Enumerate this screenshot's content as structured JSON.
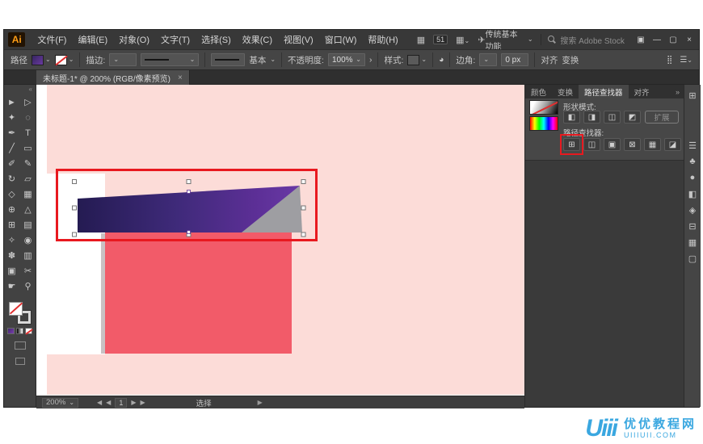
{
  "menubar": {
    "logo": "Ai",
    "menus": [
      {
        "name": "menu-file",
        "label": "文件(F)"
      },
      {
        "name": "menu-edit",
        "label": "编辑(E)"
      },
      {
        "name": "menu-object",
        "label": "对象(O)"
      },
      {
        "name": "menu-type",
        "label": "文字(T)"
      },
      {
        "name": "menu-select",
        "label": "选择(S)"
      },
      {
        "name": "menu-effect",
        "label": "效果(C)"
      },
      {
        "name": "menu-view",
        "label": "视图(V)"
      },
      {
        "name": "menu-window",
        "label": "窗口(W)"
      },
      {
        "name": "menu-help",
        "label": "帮助(H)"
      }
    ],
    "badge": "51",
    "workspace": "传统基本功能",
    "search_placeholder": "搜索 Adobe Stock"
  },
  "controlbar": {
    "path_label": "路径",
    "stroke_label": "描边:",
    "brush_name": "基本",
    "opacity_label": "不透明度:",
    "opacity_value": "100%",
    "style_label": "样式:",
    "corner_label": "边角:",
    "corner_value": "0 px",
    "align_label": "对齐",
    "transform_label": "变换"
  },
  "tabbar": {
    "doc_title": "未标题-1* @ 200% (RGB/像素预览)"
  },
  "toolbar": {
    "tools": [
      {
        "name": "selection-tool",
        "glyph": "►"
      },
      {
        "name": "direct-selection-tool",
        "glyph": "▷"
      },
      {
        "name": "magic-wand-tool",
        "glyph": "✦"
      },
      {
        "name": "lasso-tool",
        "glyph": "◌"
      },
      {
        "name": "pen-tool",
        "glyph": "✒"
      },
      {
        "name": "type-tool",
        "glyph": "T"
      },
      {
        "name": "line-segment-tool",
        "glyph": "╱"
      },
      {
        "name": "rectangle-tool",
        "glyph": "▭"
      },
      {
        "name": "paintbrush-tool",
        "glyph": "✐"
      },
      {
        "name": "pencil-tool",
        "glyph": "✎"
      },
      {
        "name": "rotate-tool",
        "glyph": "↻"
      },
      {
        "name": "scale-tool",
        "glyph": "▱"
      },
      {
        "name": "width-tool",
        "glyph": "◇"
      },
      {
        "name": "free-transform-tool",
        "glyph": "▦"
      },
      {
        "name": "shape-builder-tool",
        "glyph": "⊕"
      },
      {
        "name": "perspective-grid-tool",
        "glyph": "△"
      },
      {
        "name": "mesh-tool",
        "glyph": "⊞"
      },
      {
        "name": "gradient-tool",
        "glyph": "▤"
      },
      {
        "name": "eyedropper-tool",
        "glyph": "✧"
      },
      {
        "name": "blend-tool",
        "glyph": "◉"
      },
      {
        "name": "symbol-sprayer-tool",
        "glyph": "✽"
      },
      {
        "name": "column-graph-tool",
        "glyph": "▥"
      },
      {
        "name": "artboard-tool",
        "glyph": "▣"
      },
      {
        "name": "slice-tool",
        "glyph": "✂"
      },
      {
        "name": "hand-tool",
        "glyph": "☛"
      },
      {
        "name": "zoom-tool",
        "glyph": "⚲"
      }
    ]
  },
  "panels": {
    "tabs": [
      {
        "name": "tab-color",
        "label": "颜色"
      },
      {
        "name": "tab-transform",
        "label": "变换"
      },
      {
        "name": "tab-pathfinder",
        "label": "路径查找器"
      },
      {
        "name": "tab-align",
        "label": "对齐"
      }
    ],
    "shape_modes_label": "形状模式:",
    "shape_mode_buttons": [
      {
        "name": "unite-button",
        "glyph": "◧"
      },
      {
        "name": "minus-front-button",
        "glyph": "◨"
      },
      {
        "name": "intersect-button",
        "glyph": "◫"
      },
      {
        "name": "exclude-button",
        "glyph": "◩"
      }
    ],
    "expand_label": "扩展",
    "pathfinders_label": "路径查找器:",
    "pathfinder_buttons": [
      {
        "name": "divide-button",
        "glyph": "⊞"
      },
      {
        "name": "trim-button",
        "glyph": "◫"
      },
      {
        "name": "merge-button",
        "glyph": "▣"
      },
      {
        "name": "crop-button",
        "glyph": "⊠"
      },
      {
        "name": "outline-button",
        "glyph": "▦"
      },
      {
        "name": "minus-back-button",
        "glyph": "◪"
      }
    ],
    "strip_icons": [
      {
        "name": "libraries-panel-icon",
        "glyph": "⊞"
      },
      {
        "name": "appearance-panel-icon",
        "glyph": "☰"
      },
      {
        "name": "swatches-panel-icon",
        "glyph": "♣"
      },
      {
        "name": "color-panel-icon",
        "glyph": "●"
      },
      {
        "name": "gradient-panel-icon",
        "glyph": "◧"
      },
      {
        "name": "transparency-panel-icon",
        "glyph": "◈"
      },
      {
        "name": "stroke-panel-icon",
        "glyph": "⊟"
      },
      {
        "name": "layers-panel-icon",
        "glyph": "▦"
      },
      {
        "name": "artboards-panel-icon",
        "glyph": "▢"
      }
    ]
  },
  "statusbar": {
    "zoom": "200%",
    "artboard_number": "1",
    "tool_status": "选择"
  },
  "icons": {
    "caret": "⌄",
    "chevron_right": "›",
    "arrange_docs": "▦",
    "layout_grid": "▦",
    "send": "✈",
    "grid_dots": "⣿",
    "menu_lines": "☰",
    "dock": "▣",
    "minimize": "—",
    "restore": "▢",
    "close": "×",
    "collapse": "«",
    "tab_close": "×",
    "tabs_more": "»",
    "nav_prev": "◀",
    "nav_next": "▶",
    "marker": "▶",
    "recolor": "◕"
  },
  "colors": {
    "artboard": "#fcdcd8",
    "salmon_rect": "#f25b69",
    "purple_gradient_start": "#241b52",
    "purple_gradient_end": "#6233a0",
    "gray_face": "#9e9ea2",
    "annotation_red": "#e8191f",
    "watermark_blue": "#3aa7e0"
  },
  "watermark": {
    "logo": "Uiii",
    "site_name": "优优教程网",
    "site_url": "UIIIUII.COM"
  }
}
